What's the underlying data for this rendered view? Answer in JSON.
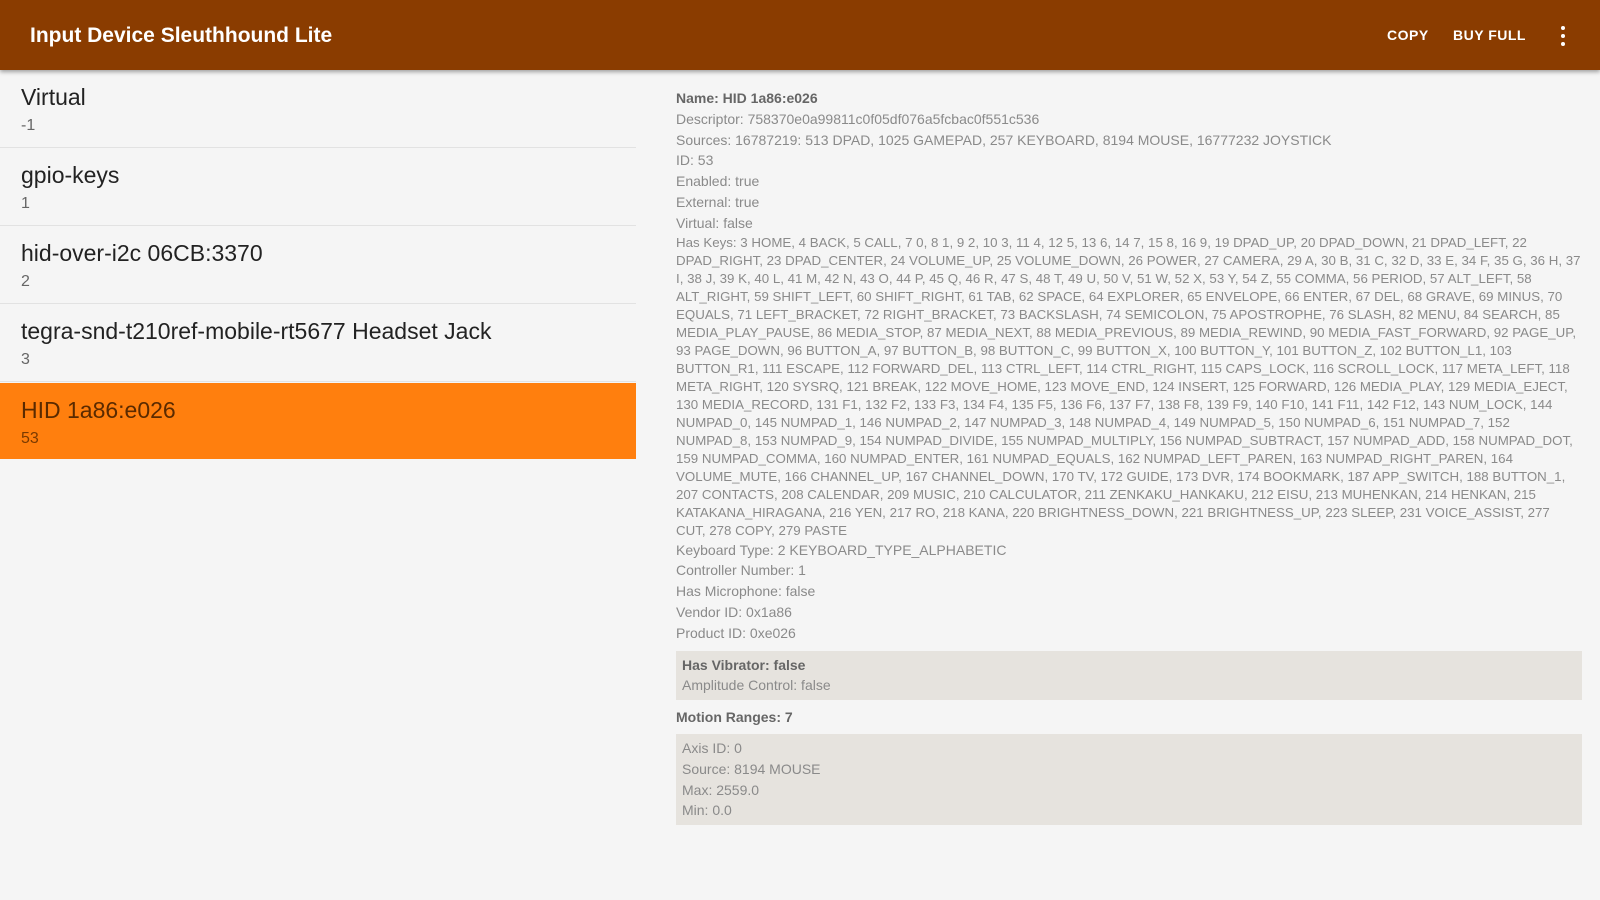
{
  "appbar": {
    "title": "Input Device Sleuthhound Lite",
    "copy_label": "COPY",
    "buy_label": "BUY FULL",
    "more_icon": "more-vert-icon",
    "color": "#8a3c00"
  },
  "devices": [
    {
      "name": "Virtual",
      "id": "-1"
    },
    {
      "name": "gpio-keys",
      "id": "1"
    },
    {
      "name": "hid-over-i2c 06CB:3370",
      "id": "2"
    },
    {
      "name": "tegra-snd-t210ref-mobile-rt5677 Headset Jack",
      "id": "3"
    },
    {
      "name": "HID 1a86:e026",
      "id": "53"
    }
  ],
  "selected_color": "#ff7f0e",
  "detail": {
    "name": "Name: HID 1a86:e026",
    "descriptor": "Descriptor: 758370e0a99811c0f05df076a5fcbac0f551c536",
    "sources": "Sources: 16787219: 513 DPAD, 1025 GAMEPAD, 257 KEYBOARD, 8194 MOUSE, 16777232 JOYSTICK",
    "id": "ID: 53",
    "enabled": "Enabled: true",
    "external": "External: true",
    "virtual": "Virtual: false",
    "has_keys": "Has Keys: 3 HOME, 4 BACK, 5 CALL, 7 0, 8 1, 9 2, 10 3, 11 4, 12 5, 13 6, 14 7, 15 8, 16 9, 19 DPAD_UP, 20 DPAD_DOWN, 21 DPAD_LEFT, 22 DPAD_RIGHT, 23 DPAD_CENTER, 24 VOLUME_UP, 25 VOLUME_DOWN, 26 POWER, 27 CAMERA, 29 A, 30 B, 31 C, 32 D, 33 E, 34 F, 35 G, 36 H, 37 I, 38 J, 39 K, 40 L, 41 M, 42 N, 43 O, 44 P, 45 Q, 46 R, 47 S, 48 T, 49 U, 50 V, 51 W, 52 X, 53 Y, 54 Z, 55 COMMA, 56 PERIOD, 57 ALT_LEFT, 58 ALT_RIGHT, 59 SHIFT_LEFT, 60 SHIFT_RIGHT, 61 TAB, 62 SPACE, 64 EXPLORER, 65 ENVELOPE, 66 ENTER, 67 DEL, 68 GRAVE, 69 MINUS, 70 EQUALS, 71 LEFT_BRACKET, 72 RIGHT_BRACKET, 73 BACKSLASH, 74 SEMICOLON, 75 APOSTROPHE, 76 SLASH, 82 MENU, 84 SEARCH, 85 MEDIA_PLAY_PAUSE, 86 MEDIA_STOP, 87 MEDIA_NEXT, 88 MEDIA_PREVIOUS, 89 MEDIA_REWIND, 90 MEDIA_FAST_FORWARD, 92 PAGE_UP, 93 PAGE_DOWN, 96 BUTTON_A, 97 BUTTON_B, 98 BUTTON_C, 99 BUTTON_X, 100 BUTTON_Y, 101 BUTTON_Z, 102 BUTTON_L1, 103 BUTTON_R1, 111 ESCAPE, 112 FORWARD_DEL, 113 CTRL_LEFT, 114 CTRL_RIGHT, 115 CAPS_LOCK, 116 SCROLL_LOCK, 117 META_LEFT, 118 META_RIGHT, 120 SYSRQ, 121 BREAK, 122 MOVE_HOME, 123 MOVE_END, 124 INSERT, 125 FORWARD, 126 MEDIA_PLAY, 129 MEDIA_EJECT, 130 MEDIA_RECORD, 131 F1, 132 F2, 133 F3, 134 F4, 135 F5, 136 F6, 137 F7, 138 F8, 139 F9, 140 F10, 141 F11, 142 F12, 143 NUM_LOCK, 144 NUMPAD_0, 145 NUMPAD_1, 146 NUMPAD_2, 147 NUMPAD_3, 148 NUMPAD_4, 149 NUMPAD_5, 150 NUMPAD_6, 151 NUMPAD_7, 152 NUMPAD_8, 153 NUMPAD_9, 154 NUMPAD_DIVIDE, 155 NUMPAD_MULTIPLY, 156 NUMPAD_SUBTRACT, 157 NUMPAD_ADD, 158 NUMPAD_DOT, 159 NUMPAD_COMMA, 160 NUMPAD_ENTER, 161 NUMPAD_EQUALS, 162 NUMPAD_LEFT_PAREN, 163 NUMPAD_RIGHT_PAREN, 164 VOLUME_MUTE, 166 CHANNEL_UP, 167 CHANNEL_DOWN, 170 TV, 172 GUIDE, 173 DVR, 174 BOOKMARK, 187 APP_SWITCH, 188 BUTTON_1, 207 CONTACTS, 208 CALENDAR, 209 MUSIC, 210 CALCULATOR, 211 ZENKAKU_HANKAKU, 212 EISU, 213 MUHENKAN, 214 HENKAN, 215 KATAKANA_HIRAGANA, 216 YEN, 217 RO, 218 KANA, 220 BRIGHTNESS_DOWN, 221 BRIGHTNESS_UP, 223 SLEEP, 231 VOICE_ASSIST, 277 CUT, 278 COPY, 279 PASTE",
    "keyboard_type": "Keyboard Type: 2 KEYBOARD_TYPE_ALPHABETIC",
    "controller_number": "Controller Number: 1",
    "has_microphone": "Has Microphone: false",
    "vendor_id": "Vendor ID: 0x1a86",
    "product_id": "Product ID: 0xe026",
    "has_vibrator": "Has Vibrator: false",
    "amplitude_control": "Amplitude Control: false",
    "motion_ranges": "Motion Ranges: 7",
    "axis": {
      "axis_id": "Axis ID: 0",
      "source": "Source: 8194 MOUSE",
      "max": "Max: 2559.0",
      "min": "Min: 0.0"
    },
    "box_color": "#e6e3de"
  }
}
